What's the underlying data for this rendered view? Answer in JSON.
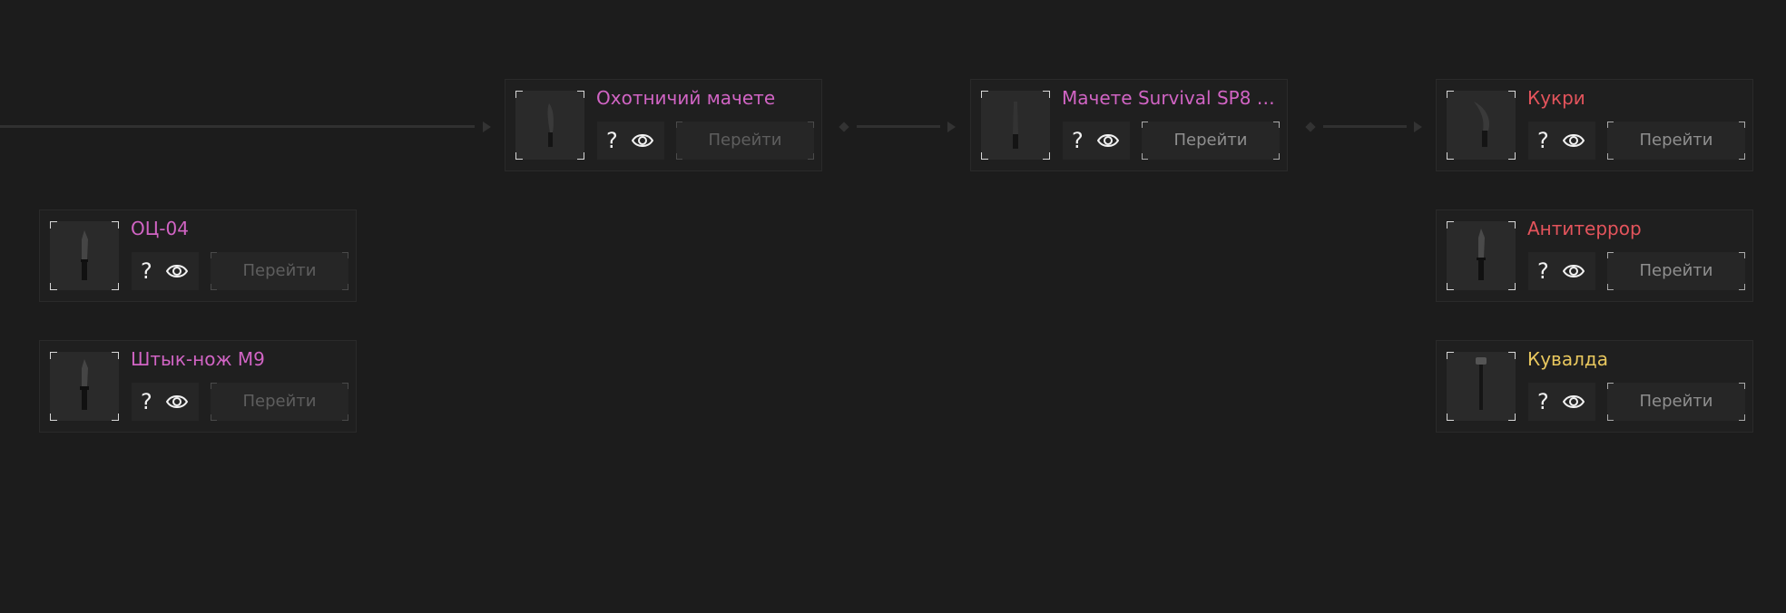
{
  "colors": {
    "background": "#1c1c1c",
    "card_background": "#1f1f1f",
    "rarity_pink": "#d164c4",
    "rarity_red": "#e4545c",
    "rarity_yellow": "#e8c75e",
    "connector": "#303030"
  },
  "actions": {
    "go_label": "Перейти",
    "help_icon": "question-mark-icon",
    "view_icon": "eye-icon"
  },
  "cards": [
    {
      "id": "hunting-machete",
      "title": "Охотничий мачете",
      "rarity_color": "#d164c4",
      "go_enabled": false,
      "item_icon": "machete-icon"
    },
    {
      "id": "machete-survival",
      "title": "Мачете Survival SP8 O..",
      "rarity_color": "#d164c4",
      "go_enabled": true,
      "item_icon": "machete-icon"
    },
    {
      "id": "kukri",
      "title": "Кукри",
      "rarity_color": "#e4545c",
      "go_enabled": true,
      "item_icon": "kukri-icon"
    },
    {
      "id": "ots-04",
      "title": "ОЦ-04",
      "rarity_color": "#d164c4",
      "go_enabled": false,
      "item_icon": "knife-icon"
    },
    {
      "id": "antiterror",
      "title": "Антитеррор",
      "rarity_color": "#e4545c",
      "go_enabled": true,
      "item_icon": "knife-icon"
    },
    {
      "id": "bayonet-m9",
      "title": "Штык-нож М9",
      "rarity_color": "#d164c4",
      "go_enabled": false,
      "item_icon": "bayonet-icon"
    },
    {
      "id": "sledgehammer",
      "title": "Кувалда",
      "rarity_color": "#e8c75e",
      "go_enabled": true,
      "item_icon": "sledgehammer-icon"
    }
  ]
}
